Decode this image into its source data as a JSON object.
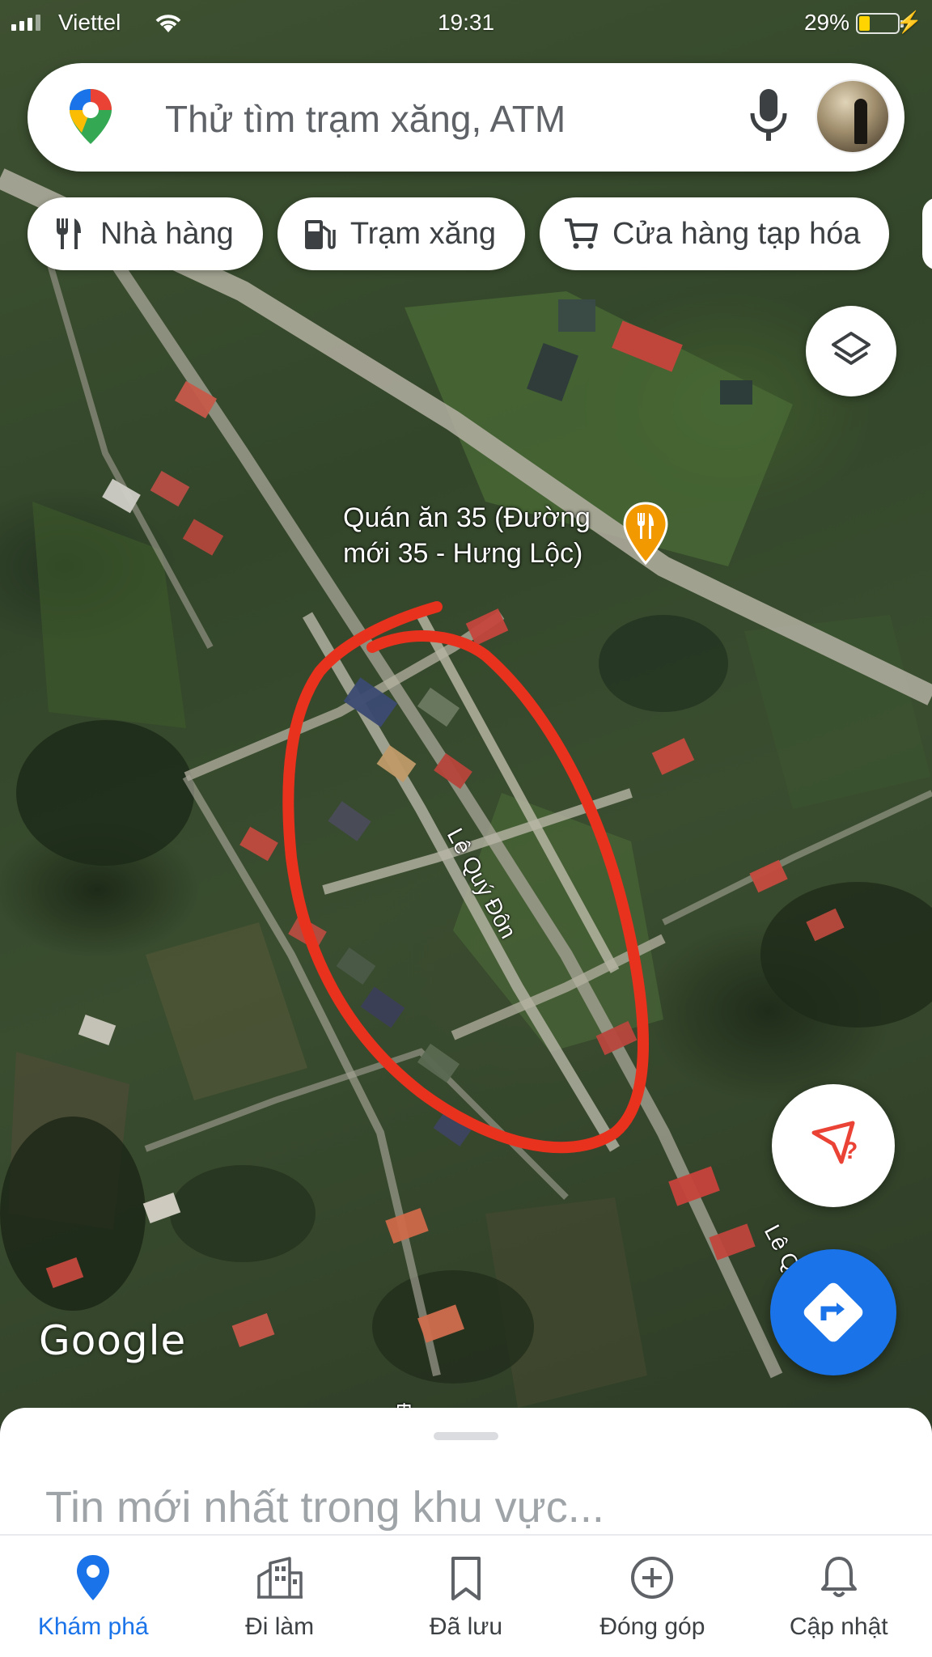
{
  "status_bar": {
    "carrier": "Viettel",
    "time": "19:31",
    "battery_percent": "29%",
    "battery_level": 0.29
  },
  "search": {
    "placeholder": "Thử tìm trạm xăng, ATM"
  },
  "chips": [
    {
      "label": "Nhà hàng",
      "icon": "restaurant-icon"
    },
    {
      "label": "Trạm xăng",
      "icon": "gas-station-icon"
    },
    {
      "label": "Cửa hàng tạp hóa",
      "icon": "shopping-cart-icon"
    }
  ],
  "map": {
    "poi": {
      "line1": "Quán ăn 35 (Đường",
      "line2": "mới 35 - Hưng Lộc)",
      "icon": "restaurant-pin-icon",
      "pin_color": "#f29900"
    },
    "streets": [
      "Lê Quý Đôn",
      "Lê Q",
      "Đ"
    ],
    "attribution": "Google",
    "annotation_color": "#e8321e"
  },
  "sheet": {
    "title": "Tin mới nhất trong khu vực..."
  },
  "nav": [
    {
      "label": "Khám phá",
      "icon": "location-pin-icon",
      "active": true
    },
    {
      "label": "Đi làm",
      "icon": "commute-icon",
      "active": false
    },
    {
      "label": "Đã lưu",
      "icon": "bookmark-icon",
      "active": false
    },
    {
      "label": "Đóng góp",
      "icon": "add-circle-icon",
      "active": false
    },
    {
      "label": "Cập nhật",
      "icon": "bell-icon",
      "active": false
    }
  ],
  "colors": {
    "accent": "#1a73e8",
    "text_secondary": "#5f6368"
  }
}
